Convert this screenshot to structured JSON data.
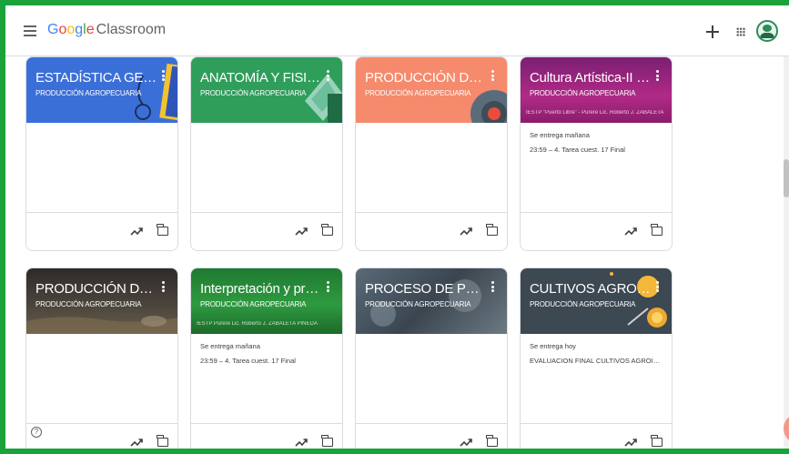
{
  "app": {
    "logo_google": [
      "G",
      "o",
      "o",
      "g",
      "l",
      "e"
    ],
    "logo_product": "Classroom"
  },
  "colors": {
    "frame_border": "#1aa33a",
    "card1": "#3b6fd8",
    "card2": "#2f9e5b",
    "card3": "#f58a6c",
    "card4": "#a8287c",
    "card5": "#3d3a36",
    "card6": "#2e8b3e",
    "card7": "#4a5560",
    "card8": "#3c4852"
  },
  "cards": [
    {
      "title": "ESTADÍSTICA GENER...",
      "section": "PRODUCCIÓN AGROPECUARIA",
      "due_label": "",
      "due_text": ""
    },
    {
      "title": "ANATOMÍA Y FISIOL...",
      "section": "PRODUCCIÓN AGROPECUARIA",
      "due_label": "",
      "due_text": ""
    },
    {
      "title": "PRODUCCIÓN DE C...",
      "section": "PRODUCCIÓN AGROPECUARIA",
      "due_label": "",
      "due_text": ""
    },
    {
      "title": "Cultura Artística-II Se...",
      "section": "PRODUCCIÓN AGROPECUARIA",
      "banner_text": "IESTP \"Puerto Libre\" - Purere   Lic. Roberto J. ZABALETA",
      "due_label": "Se entrega mañana",
      "due_text": "23:59 – 4. Tarea cuest. 17 Final"
    },
    {
      "title": "PRODUCCIÓN DE AV...",
      "section": "PRODUCCIÓN AGROPECUARIA",
      "due_label": "",
      "due_text": ""
    },
    {
      "title": "Interpretación y prod...",
      "section": "PRODUCCIÓN AGROPECUARIA",
      "banner_text": "IESTP   Purere   Lic. Roberto J. ZABALETA PINEDA",
      "due_label": "Se entrega mañana",
      "due_text": "23:59 – 4. Tarea cuest. 17 Final"
    },
    {
      "title": "PROCESO DE PROD...",
      "section": "PRODUCCIÓN AGROPECUARIA",
      "due_label": "",
      "due_text": ""
    },
    {
      "title": "CULTIVOS AGROIND...",
      "section": "PRODUCCIÓN AGROPECUARIA",
      "due_label": "Se entrega hoy",
      "due_text": "EVALUACION FINAL CULTIVOS AGROINDUS..."
    }
  ],
  "icons": {
    "menu": "menu-icon",
    "create": "plus-icon",
    "apps": "apps-grid-icon",
    "avatar": "account-avatar",
    "trend": "trending-up-icon",
    "folder": "folder-icon",
    "help": "help-icon"
  },
  "help_glyph": "?"
}
